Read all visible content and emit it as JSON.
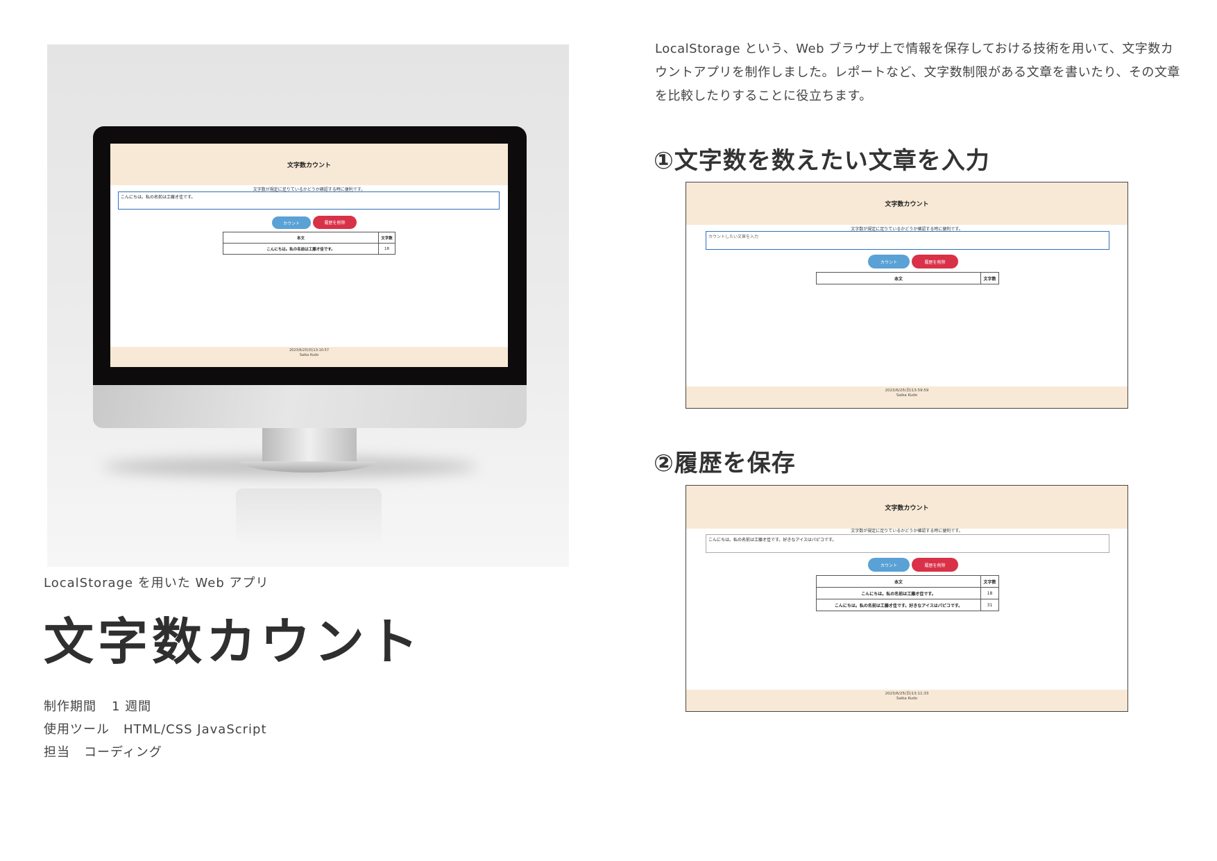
{
  "description": "LocalStorage という、Web ブラウザ上で情報を保存しておける技術を用いて、文字数カウントアプリを制作しました。レポートなど、文字数制限がある文章を書いたり、その文章を比較したりすることに役立ちます。",
  "app_caption": "LocalStorage を用いた Web アプリ",
  "app_title": "文字数カウント",
  "meta": [
    {
      "label": "制作期間",
      "value": "1 週間"
    },
    {
      "label": "使用ツール",
      "value": "HTML/CSS JavaScript"
    },
    {
      "label": "担当",
      "value": "コーディング"
    }
  ],
  "steps": [
    {
      "heading": "①文字数を数えたい文章を入力"
    },
    {
      "heading": "②履歴を保存"
    }
  ],
  "app": {
    "header_title": "文字数カウント",
    "subtitle": "文字数が規定に足りているかどうか確認する時に便利です。",
    "count_button": "カウント",
    "clear_button": "履歴を削除",
    "col_text": "本文",
    "col_count": "文字数",
    "author": "Saika Kudo"
  },
  "screens": {
    "monitor": {
      "input_value": "こんにちは。私の名前は工藤才佳です。",
      "rows": [
        {
          "text": "こんにちは。私の名前は工藤才佳です。",
          "count": "18"
        }
      ],
      "timestamp": "2023/6/25(日)13:10:57"
    },
    "step1": {
      "input_placeholder": "カウントしたい文章を入力",
      "rows": [],
      "timestamp": "2023/6/25(日)13:59:59"
    },
    "step2": {
      "input_value": "こんにちは。私の名前は工藤才佳です。好きなアイスはパピコです。",
      "rows": [
        {
          "text": "こんにちは。私の名前は工藤才佳です。",
          "count": "18"
        },
        {
          "text": "こんにちは。私の名前は工藤才佳です。好きなアイスはパピコです。",
          "count": "31"
        }
      ],
      "timestamp": "2023/6/25(日)13:11:33"
    }
  }
}
